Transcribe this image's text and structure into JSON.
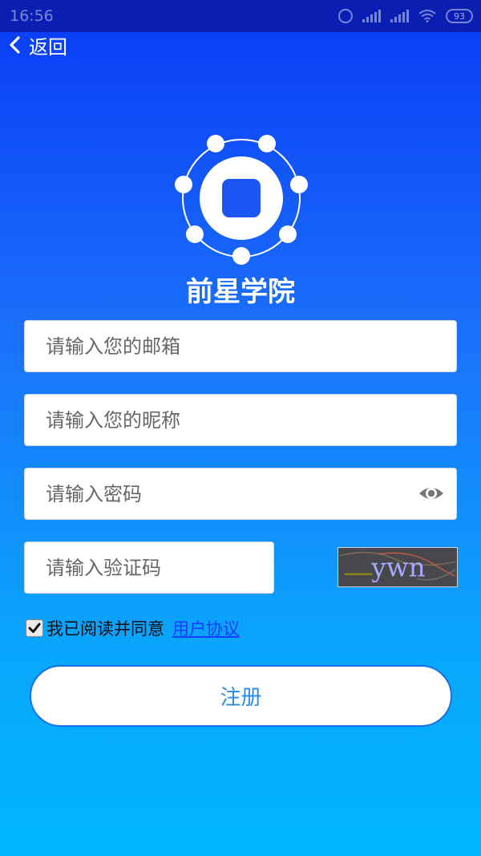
{
  "status_bar": {
    "time": "16:56",
    "battery": "93"
  },
  "nav": {
    "back_label": "返回"
  },
  "brand": {
    "name": "前星学院"
  },
  "form": {
    "email_placeholder": "请输入您的邮箱",
    "nickname_placeholder": "请输入您的昵称",
    "password_placeholder": "请输入密码",
    "captcha_placeholder": "请输入验证码",
    "captcha_text": "ywn",
    "agree_checked": true,
    "agree_text": "我已阅读并同意",
    "agreement_link": "用户协议",
    "submit_label": "注册"
  },
  "icons": {
    "back": "chevron-left-icon",
    "password_toggle": "eye-icon",
    "logo": "app-logo-icon"
  },
  "colors": {
    "gradient_top": "#0a3af6",
    "gradient_bottom": "#00b6fe",
    "status_bar": "#0a1fb2",
    "link": "#1a3cff",
    "button_text": "#2a8ee8"
  }
}
